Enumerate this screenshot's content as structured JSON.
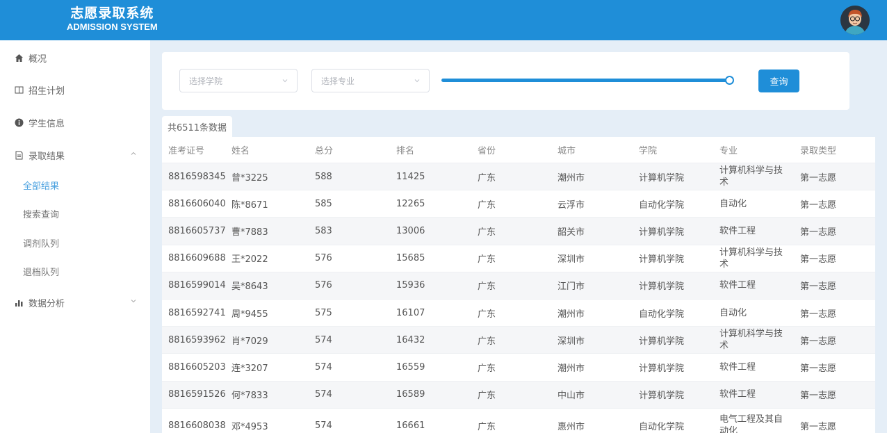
{
  "header": {
    "logo_cn": "志愿录取系统",
    "logo_en": "ADMISSION SYSTEM",
    "avatar_icon": "user-avatar-icon",
    "background": "#1f8ed8"
  },
  "sidebar": {
    "items": [
      {
        "label": "概况",
        "icon": "home-icon"
      },
      {
        "label": "招生计划",
        "icon": "book-icon"
      },
      {
        "label": "学生信息",
        "icon": "info-icon"
      },
      {
        "label": "录取结果",
        "icon": "document-icon",
        "expanded": true
      },
      {
        "label": "数据分析",
        "icon": "bar-chart-icon",
        "expanded": false
      }
    ],
    "sub_items": [
      {
        "label": "全部结果",
        "active": true
      },
      {
        "label": "搜索查询",
        "active": false
      },
      {
        "label": "调剂队列",
        "active": false
      },
      {
        "label": "退档队列",
        "active": false
      }
    ]
  },
  "filters": {
    "college_placeholder": "选择学院",
    "major_placeholder": "选择专业",
    "slider_value": 1.0,
    "query_label": "查询"
  },
  "table": {
    "count_label": "共6511条数据",
    "headers": [
      "准考证号",
      "姓名",
      "总分",
      "排名",
      "省份",
      "城市",
      "学院",
      "专业",
      "录取类型"
    ],
    "rows": [
      [
        "8816598345",
        "曾*3225",
        "588",
        "11425",
        "广东",
        "潮州市",
        "计算机学院",
        "计算机科学与技术",
        "第一志愿"
      ],
      [
        "8816606040",
        "陈*8671",
        "585",
        "12265",
        "广东",
        "云浮市",
        "自动化学院",
        "自动化",
        "第一志愿"
      ],
      [
        "8816605737",
        "曹*7883",
        "583",
        "13006",
        "广东",
        "韶关市",
        "计算机学院",
        "软件工程",
        "第一志愿"
      ],
      [
        "8816609688",
        "王*2022",
        "576",
        "15685",
        "广东",
        "深圳市",
        "计算机学院",
        "计算机科学与技术",
        "第一志愿"
      ],
      [
        "8816599014",
        "吴*8643",
        "576",
        "15936",
        "广东",
        "江门市",
        "计算机学院",
        "软件工程",
        "第一志愿"
      ],
      [
        "8816592741",
        "周*9455",
        "575",
        "16107",
        "广东",
        "潮州市",
        "自动化学院",
        "自动化",
        "第一志愿"
      ],
      [
        "8816593962",
        "肖*7029",
        "574",
        "16432",
        "广东",
        "深圳市",
        "计算机学院",
        "计算机科学与技术",
        "第一志愿"
      ],
      [
        "8816605203",
        "连*3207",
        "574",
        "16559",
        "广东",
        "潮州市",
        "计算机学院",
        "软件工程",
        "第一志愿"
      ],
      [
        "8816591526",
        "何*7833",
        "574",
        "16589",
        "广东",
        "中山市",
        "计算机学院",
        "软件工程",
        "第一志愿"
      ],
      [
        "8816608038",
        "邓*4953",
        "574",
        "16661",
        "广东",
        "惠州市",
        "自动化学院",
        "电气工程及其自动化",
        "第一志愿"
      ]
    ]
  }
}
